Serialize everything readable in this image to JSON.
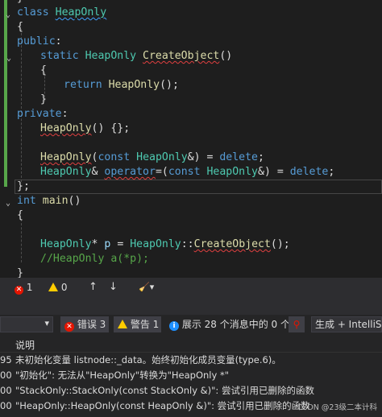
{
  "editor": {
    "lines": [
      [
        {
          "t": "}",
          "c": "pl"
        }
      ],
      [
        {
          "t": "class ",
          "c": "kw"
        },
        {
          "t": "HeapOnly",
          "c": "ty sqg"
        }
      ],
      [
        {
          "t": "{",
          "c": "pl"
        }
      ],
      [
        {
          "t": "public",
          "c": "kw"
        },
        {
          "t": ":",
          "c": "pl"
        }
      ],
      [
        {
          "t": "static ",
          "c": "kw"
        },
        {
          "t": "HeapOnly ",
          "c": "ty"
        },
        {
          "t": "CreateObject",
          "c": "fn sq"
        },
        {
          "t": "()",
          "c": "pl"
        }
      ],
      [
        {
          "t": "{",
          "c": "pl"
        }
      ],
      [
        {
          "t": "return ",
          "c": "kw"
        },
        {
          "t": "HeapOnly",
          "c": "fn"
        },
        {
          "t": "();",
          "c": "pl"
        }
      ],
      [
        {
          "t": "}",
          "c": "pl"
        }
      ],
      [
        {
          "t": "private",
          "c": "kw"
        },
        {
          "t": ":",
          "c": "pl"
        }
      ],
      [
        {
          "t": "HeapOnly",
          "c": "fn sq"
        },
        {
          "t": "() {};",
          "c": "pl"
        }
      ],
      [],
      [
        {
          "t": "HeapOnly",
          "c": "fn sq"
        },
        {
          "t": "(",
          "c": "pl"
        },
        {
          "t": "const ",
          "c": "kw"
        },
        {
          "t": "HeapOnly",
          "c": "ty"
        },
        {
          "t": "&) = ",
          "c": "pl"
        },
        {
          "t": "delete",
          "c": "kw"
        },
        {
          "t": ";",
          "c": "pl"
        }
      ],
      [
        {
          "t": "HeapOnly",
          "c": "ty"
        },
        {
          "t": "& ",
          "c": "pl"
        },
        {
          "t": "operator",
          "c": "kw sq"
        },
        {
          "t": "=(",
          "c": "pl"
        },
        {
          "t": "const ",
          "c": "kw"
        },
        {
          "t": "HeapOnly",
          "c": "ty"
        },
        {
          "t": "&) = ",
          "c": "pl"
        },
        {
          "t": "delete",
          "c": "kw"
        },
        {
          "t": ";",
          "c": "pl"
        }
      ],
      [
        {
          "t": "};",
          "c": "pl"
        }
      ],
      [
        {
          "t": "int ",
          "c": "kw"
        },
        {
          "t": "main",
          "c": "fn"
        },
        {
          "t": "()",
          "c": "pl"
        }
      ],
      [
        {
          "t": "{",
          "c": "pl"
        }
      ],
      [],
      [
        {
          "t": "HeapOnly",
          "c": "ty"
        },
        {
          "t": "* ",
          "c": "pl"
        },
        {
          "t": "p",
          "c": "var"
        },
        {
          "t": " = ",
          "c": "pl"
        },
        {
          "t": "HeapOnly",
          "c": "ty"
        },
        {
          "t": "::",
          "c": "pl"
        },
        {
          "t": "CreateObject",
          "c": "fn sq"
        },
        {
          "t": "();",
          "c": "pl"
        }
      ],
      [
        {
          "t": "//HeapOnly a(*p);",
          "c": "cm"
        }
      ],
      [
        {
          "t": "}",
          "c": "pl"
        }
      ]
    ]
  },
  "status": {
    "errors": "1",
    "warnings": "0",
    "up_arrow": "↑",
    "down_arrow": "↓",
    "brush_glyph": "🧹▾"
  },
  "error_list": {
    "errors_btn": "错误 3",
    "warnings_btn": "警告 1",
    "messages_btn": "展示 28 个消息中的 0 个",
    "build_select": "生成 + IntelliSen",
    "column_desc": "说明",
    "rows": [
      {
        "code": "95",
        "desc": "未初始化变量 listnode::_data。始终初始化成员变量(type.6)。"
      },
      {
        "code": "00",
        "desc": "\"初始化\": 无法从\"HeapOnly\"转换为\"HeapOnly *\""
      },
      {
        "code": "00",
        "desc": "\"StackOnly::StackOnly(const StackOnly &)\": 尝试引用已删除的函数"
      },
      {
        "code": "00",
        "desc": "\"HeapOnly::HeapOnly(const HeapOnly &)\": 尝试引用已删除的函数"
      }
    ]
  },
  "watermark": "CSDN @23级二本计科",
  "colors": {
    "background": "#1e1e1e",
    "keyword": "#569cd6",
    "type": "#4ec9b0",
    "function": "#dcdcaa",
    "comment": "#57a64a",
    "error": "#e51400",
    "warning": "#ffcc00"
  }
}
